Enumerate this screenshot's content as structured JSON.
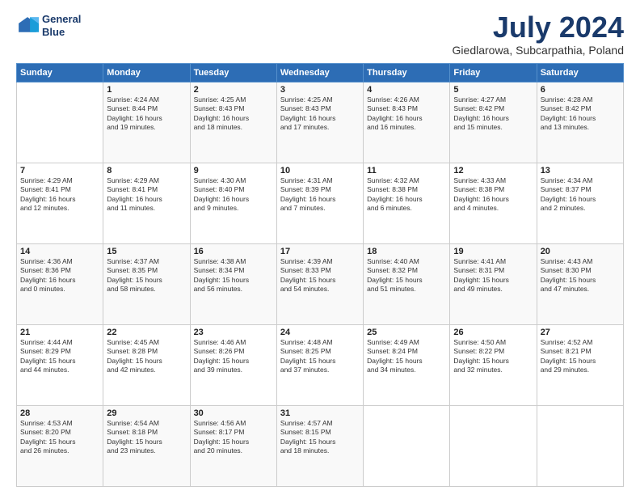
{
  "header": {
    "logo_line1": "General",
    "logo_line2": "Blue",
    "month": "July 2024",
    "location": "Giedlarowa, Subcarpathia, Poland"
  },
  "weekdays": [
    "Sunday",
    "Monday",
    "Tuesday",
    "Wednesday",
    "Thursday",
    "Friday",
    "Saturday"
  ],
  "weeks": [
    [
      {
        "day": "",
        "info": ""
      },
      {
        "day": "1",
        "info": "Sunrise: 4:24 AM\nSunset: 8:44 PM\nDaylight: 16 hours\nand 19 minutes."
      },
      {
        "day": "2",
        "info": "Sunrise: 4:25 AM\nSunset: 8:43 PM\nDaylight: 16 hours\nand 18 minutes."
      },
      {
        "day": "3",
        "info": "Sunrise: 4:25 AM\nSunset: 8:43 PM\nDaylight: 16 hours\nand 17 minutes."
      },
      {
        "day": "4",
        "info": "Sunrise: 4:26 AM\nSunset: 8:43 PM\nDaylight: 16 hours\nand 16 minutes."
      },
      {
        "day": "5",
        "info": "Sunrise: 4:27 AM\nSunset: 8:42 PM\nDaylight: 16 hours\nand 15 minutes."
      },
      {
        "day": "6",
        "info": "Sunrise: 4:28 AM\nSunset: 8:42 PM\nDaylight: 16 hours\nand 13 minutes."
      }
    ],
    [
      {
        "day": "7",
        "info": "Sunrise: 4:29 AM\nSunset: 8:41 PM\nDaylight: 16 hours\nand 12 minutes."
      },
      {
        "day": "8",
        "info": "Sunrise: 4:29 AM\nSunset: 8:41 PM\nDaylight: 16 hours\nand 11 minutes."
      },
      {
        "day": "9",
        "info": "Sunrise: 4:30 AM\nSunset: 8:40 PM\nDaylight: 16 hours\nand 9 minutes."
      },
      {
        "day": "10",
        "info": "Sunrise: 4:31 AM\nSunset: 8:39 PM\nDaylight: 16 hours\nand 7 minutes."
      },
      {
        "day": "11",
        "info": "Sunrise: 4:32 AM\nSunset: 8:38 PM\nDaylight: 16 hours\nand 6 minutes."
      },
      {
        "day": "12",
        "info": "Sunrise: 4:33 AM\nSunset: 8:38 PM\nDaylight: 16 hours\nand 4 minutes."
      },
      {
        "day": "13",
        "info": "Sunrise: 4:34 AM\nSunset: 8:37 PM\nDaylight: 16 hours\nand 2 minutes."
      }
    ],
    [
      {
        "day": "14",
        "info": "Sunrise: 4:36 AM\nSunset: 8:36 PM\nDaylight: 16 hours\nand 0 minutes."
      },
      {
        "day": "15",
        "info": "Sunrise: 4:37 AM\nSunset: 8:35 PM\nDaylight: 15 hours\nand 58 minutes."
      },
      {
        "day": "16",
        "info": "Sunrise: 4:38 AM\nSunset: 8:34 PM\nDaylight: 15 hours\nand 56 minutes."
      },
      {
        "day": "17",
        "info": "Sunrise: 4:39 AM\nSunset: 8:33 PM\nDaylight: 15 hours\nand 54 minutes."
      },
      {
        "day": "18",
        "info": "Sunrise: 4:40 AM\nSunset: 8:32 PM\nDaylight: 15 hours\nand 51 minutes."
      },
      {
        "day": "19",
        "info": "Sunrise: 4:41 AM\nSunset: 8:31 PM\nDaylight: 15 hours\nand 49 minutes."
      },
      {
        "day": "20",
        "info": "Sunrise: 4:43 AM\nSunset: 8:30 PM\nDaylight: 15 hours\nand 47 minutes."
      }
    ],
    [
      {
        "day": "21",
        "info": "Sunrise: 4:44 AM\nSunset: 8:29 PM\nDaylight: 15 hours\nand 44 minutes."
      },
      {
        "day": "22",
        "info": "Sunrise: 4:45 AM\nSunset: 8:28 PM\nDaylight: 15 hours\nand 42 minutes."
      },
      {
        "day": "23",
        "info": "Sunrise: 4:46 AM\nSunset: 8:26 PM\nDaylight: 15 hours\nand 39 minutes."
      },
      {
        "day": "24",
        "info": "Sunrise: 4:48 AM\nSunset: 8:25 PM\nDaylight: 15 hours\nand 37 minutes."
      },
      {
        "day": "25",
        "info": "Sunrise: 4:49 AM\nSunset: 8:24 PM\nDaylight: 15 hours\nand 34 minutes."
      },
      {
        "day": "26",
        "info": "Sunrise: 4:50 AM\nSunset: 8:22 PM\nDaylight: 15 hours\nand 32 minutes."
      },
      {
        "day": "27",
        "info": "Sunrise: 4:52 AM\nSunset: 8:21 PM\nDaylight: 15 hours\nand 29 minutes."
      }
    ],
    [
      {
        "day": "28",
        "info": "Sunrise: 4:53 AM\nSunset: 8:20 PM\nDaylight: 15 hours\nand 26 minutes."
      },
      {
        "day": "29",
        "info": "Sunrise: 4:54 AM\nSunset: 8:18 PM\nDaylight: 15 hours\nand 23 minutes."
      },
      {
        "day": "30",
        "info": "Sunrise: 4:56 AM\nSunset: 8:17 PM\nDaylight: 15 hours\nand 20 minutes."
      },
      {
        "day": "31",
        "info": "Sunrise: 4:57 AM\nSunset: 8:15 PM\nDaylight: 15 hours\nand 18 minutes."
      },
      {
        "day": "",
        "info": ""
      },
      {
        "day": "",
        "info": ""
      },
      {
        "day": "",
        "info": ""
      }
    ]
  ]
}
